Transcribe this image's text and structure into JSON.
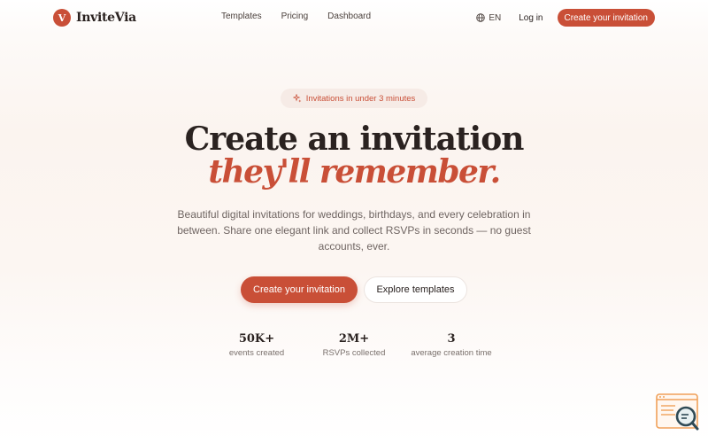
{
  "brand": {
    "mark": "V",
    "name": "InviteVia",
    "color": "#c94f37"
  },
  "nav": {
    "links": [
      "Templates",
      "Pricing",
      "Dashboard"
    ],
    "language": "EN",
    "login": "Log in",
    "cta": "Create your invitation"
  },
  "hero": {
    "badge": "Invitations in under 3 minutes",
    "title_line1": "Create an invitation",
    "title_line2": "they'll remember.",
    "subtitle": "Beautiful digital invitations for weddings, birthdays, and every celebration in between. Share one elegant link and collect RSVPs in seconds — no guest accounts, ever.",
    "primary_button": "Create your invitation",
    "secondary_button": "Explore templates"
  },
  "stats": [
    {
      "value": "50K+",
      "label": "events created"
    },
    {
      "value": "2M+",
      "label": "RSVPs collected"
    },
    {
      "value": "3",
      "label": "average creation time"
    }
  ],
  "icons": {
    "globe": "globe-icon",
    "sparkle": "sparkle-icon",
    "widget": "search-document-icon"
  }
}
